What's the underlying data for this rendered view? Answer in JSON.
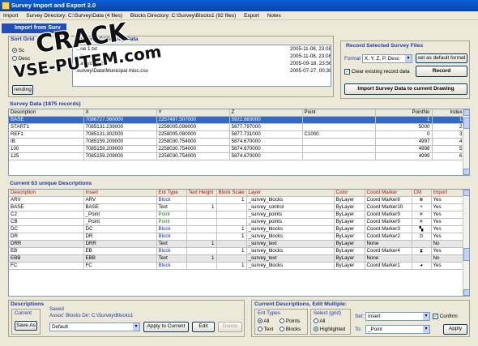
{
  "window": {
    "title": "Survey Import and Export 2.0"
  },
  "menu": [
    "Import",
    "Survey Directory: C:\\Survey\\Data (4 files)",
    "Blocks Directory: C:\\Survey\\Blocks1 (92 files)",
    "Export",
    "Notes"
  ],
  "import_panel": {
    "tab_title": "Import from Surv",
    "sort_group_title": "Sort Grid",
    "directory_title": "rectory: C:\\Survey\\Data",
    "sort_options": [
      "Sc",
      "Desc"
    ],
    "sort_selected": 0,
    "refresh_label": "rending",
    "files": [
      {
        "name": "...ne 1.txt",
        "date": "2005-11-08, 23:08"
      },
      {
        "name": "...iew zone 2.txt",
        "date": "2005-11-08, 23:08"
      },
      {
        "name": "...al works.csv",
        "date": "2005-09-18, 23:56"
      },
      {
        "name": "Survey\\Data\\Municipal misc.csv",
        "date": "2005-07-27, 00:39"
      }
    ]
  },
  "record_panel": {
    "title": "Record Selected Survey Files",
    "format_label": "Format",
    "format_value": "X, Y, Z, P, Desc",
    "set_default_label": "set as default format",
    "record_label": "Record",
    "clear_label": "Clear existing record data",
    "clear_checked": true,
    "import_label": "Import Survey Data to current Drawing"
  },
  "survey_data": {
    "title": "Survey Data (1875 records)",
    "columns": [
      "Description",
      "X",
      "Y",
      "Z",
      "Point",
      "PointNo",
      "Index"
    ],
    "rows": [
      [
        "BASE",
        "7086727.360000",
        "2257487.307000",
        "5922.683000",
        "",
        "1",
        "1"
      ],
      [
        "START1",
        "7085131.239000",
        "2258005.098000",
        "5877.797000",
        "",
        "5000",
        "2"
      ],
      [
        "REF1",
        "7085131.302000",
        "2258005.080000",
        "5877.731000",
        "C1000",
        "0",
        "3"
      ],
      [
        "IB",
        "7085159.209000",
        "2258030.754000",
        "5874.670000",
        "",
        "4997",
        "4"
      ],
      [
        "100",
        "7085159.209000",
        "2258030.754000",
        "5874.670000",
        "",
        "4998",
        "5"
      ],
      [
        "125",
        "7085159.209000",
        "2258030.754000",
        "5874.670000",
        "",
        "4999",
        "6"
      ]
    ],
    "selected_row": 0
  },
  "descriptions": {
    "title": "Current 63 unique Descriptions",
    "columns": [
      "Description",
      "Insert",
      "Ent Type",
      "Text Height",
      "Block Scale",
      "Layer",
      "Color",
      "Coord Marker",
      "CM",
      "Import"
    ],
    "rows": [
      [
        "ARV",
        "ARV",
        "Block",
        "",
        "1",
        "_survey_blocks",
        "ByLayer",
        "Coord Marker8",
        "⊗",
        "Yes"
      ],
      [
        "BASE",
        "BASE",
        "Text",
        "1",
        "",
        "_survey_control",
        "ByLayer",
        "Coord Marker10",
        "+",
        "Yes"
      ],
      [
        "C2",
        "_Point",
        "Point",
        "",
        "",
        "_survey_points",
        "ByLayer",
        "Coord Marker9",
        "✕",
        "Yes"
      ],
      [
        "CB",
        "_Point",
        "Point",
        "",
        "",
        "_survey_points",
        "ByLayer",
        "Coord Marker9",
        "✕",
        "Yes"
      ],
      [
        "DC",
        "DC",
        "Block",
        "",
        "1",
        "_survey_blocks",
        "ByLayer",
        "Coord Marker3",
        "▚",
        "Yes"
      ],
      [
        "DR",
        "DR",
        "Block",
        "",
        "1",
        "_survey_blocks",
        "ByLayer",
        "Coord Marker2",
        "⊙",
        "Yes"
      ],
      [
        "DRR",
        "DRR",
        "Text",
        "1",
        "",
        "_survey_text",
        "ByLayer",
        "None",
        "",
        "No"
      ],
      [
        "EB",
        "EB",
        "Block",
        "",
        "1",
        "_survey_blocks",
        "ByLayer",
        "Coord Marker4",
        "⧗",
        "Yes"
      ],
      [
        "EBB",
        "EBB",
        "Text",
        "1",
        "",
        "_survey_text",
        "ByLayer",
        "None",
        "",
        "No"
      ],
      [
        "FC",
        "FC",
        "Block",
        "",
        "1",
        "_survey_blocks",
        "ByLayer",
        "Coord Marker1",
        "◕",
        "Yes"
      ]
    ],
    "grey_rows": [
      6,
      8
    ]
  },
  "bottom_descriptions": {
    "title": "Descriptions",
    "current_label": "Current",
    "save_as_label": "Save As",
    "saved_label": "Saved",
    "assoc_label": "Assoc' Blocks Dir: C:\\Survey\\Blocks1",
    "saved_value": "Default",
    "apply_label": "Apply to Current",
    "edit_label": "Edit",
    "delete_label": "Delete"
  },
  "edit_multiple": {
    "title": "Current Descriptions, Edit Multiple:",
    "ent_types_label": "Ent Types",
    "ent_all": "All",
    "ent_points": "Points",
    "ent_text": "Text",
    "ent_blocks": "Blocks",
    "select_label": "Select (grid)",
    "sel_all": "All",
    "sel_highlighted": "Highlighted",
    "set_label": "Set:",
    "set_value": "Insert",
    "to_label": "To:",
    "to_value": "_Point",
    "confirm_label": "Confirm",
    "confirm_checked": true,
    "apply_label": "Apply"
  },
  "watermark": {
    "line1": "CRACK",
    "line2": "VSE-PUTEM.com"
  },
  "colors": {
    "accent": "#1a3aa8",
    "selection": "#316ac5",
    "header_red": "#b01010"
  }
}
